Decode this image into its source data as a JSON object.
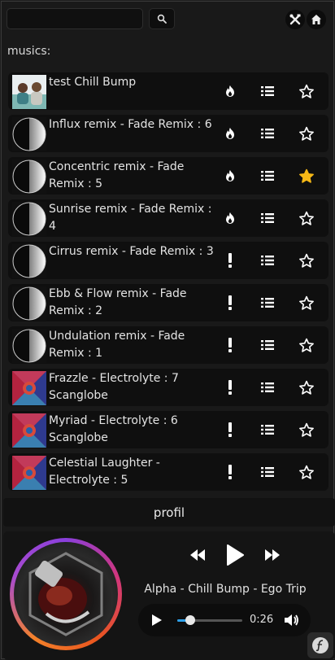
{
  "search": {
    "placeholder": "",
    "value": ""
  },
  "header": {
    "search_icon": "search-icon",
    "tools_icon": "tools-icon",
    "home_icon": "home-icon"
  },
  "section_title": "musics:",
  "tracks": [
    {
      "title": "test  Chill Bump",
      "cover": "photo-two-people",
      "hot_state": "flame",
      "favorite": false
    },
    {
      "title": "Influx remix  - Fade Remix : 6",
      "cover": "half-circle",
      "hot_state": "flame",
      "favorite": false
    },
    {
      "title": "Concentric remix  - Fade Remix : 5",
      "cover": "half-circle",
      "hot_state": "flame",
      "favorite": true
    },
    {
      "title": "Sunrise remix  - Fade Remix : 4",
      "cover": "half-circle",
      "hot_state": "flame",
      "favorite": false
    },
    {
      "title": "Cirrus remix  - Fade Remix : 3",
      "cover": "half-circle",
      "hot_state": "exclamation",
      "favorite": false
    },
    {
      "title": "Ebb & Flow remix  - Fade Remix : 2",
      "cover": "half-circle",
      "hot_state": "exclamation",
      "favorite": false
    },
    {
      "title": "Undulation remix  - Fade Remix : 1",
      "cover": "half-circle",
      "hot_state": "exclamation",
      "favorite": false
    },
    {
      "title": "Frazzle  - Electrolyte : 7 Scanglobe",
      "cover": "kaleidoscope",
      "hot_state": "exclamation",
      "favorite": false
    },
    {
      "title": "Myriad  - Electrolyte : 6 Scanglobe",
      "cover": "kaleidoscope",
      "hot_state": "exclamation",
      "favorite": false
    },
    {
      "title": "Celestial Laughter  - Electrolyte : 5",
      "cover": "kaleidoscope",
      "hot_state": "exclamation",
      "favorite": false
    }
  ],
  "profile_button": "profil",
  "player": {
    "now_playing": "Alpha - Chill Bump - Ego Trip",
    "elapsed": "0:26",
    "progress": 0.2,
    "state": "paused"
  },
  "colors": {
    "accent": "#2c9fe8",
    "star_fav": "#f5b816",
    "background": "#191919"
  }
}
